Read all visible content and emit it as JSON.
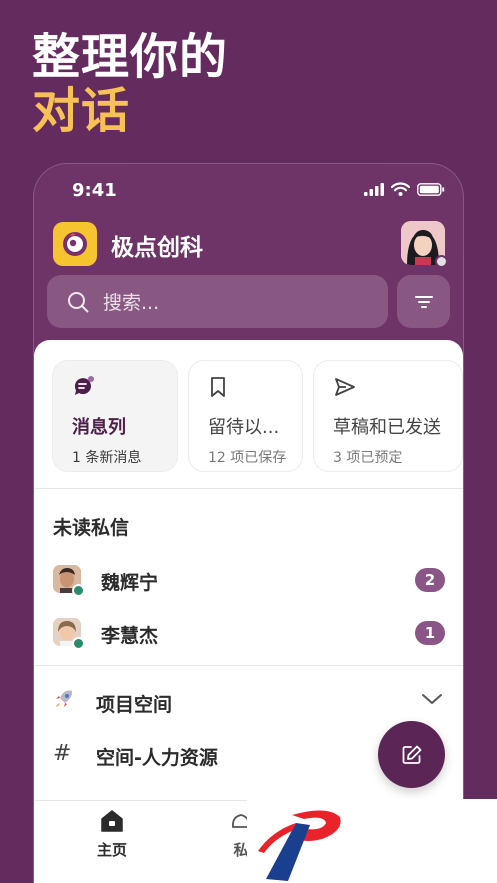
{
  "headline": {
    "line1": "整理你的",
    "line2": "对话"
  },
  "status_bar": {
    "time": "9:41"
  },
  "workspace": {
    "name": "极点创科"
  },
  "search": {
    "placeholder": "搜索..."
  },
  "cards": [
    {
      "icon": "message-list-icon",
      "title": "消息列",
      "subtitle": "1 条新消息",
      "active": true
    },
    {
      "icon": "bookmark-icon",
      "title": "留待以...",
      "subtitle": "12 项已保存",
      "active": false
    },
    {
      "icon": "send-icon",
      "title": "草稿和已发送",
      "subtitle": "3 项已预定",
      "active": false
    }
  ],
  "unread_dms": {
    "label": "未读私信",
    "items": [
      {
        "name": "魏辉宁",
        "count": "2"
      },
      {
        "name": "李慧杰",
        "count": "1"
      }
    ]
  },
  "channels": [
    {
      "icon": "rocket-icon",
      "name": "项目空间"
    },
    {
      "icon": "hash-icon",
      "name": "空间-人力资源"
    }
  ],
  "tabbar": [
    {
      "icon": "home-icon",
      "label": "主页"
    },
    {
      "icon": "dm-icon",
      "label": "私"
    }
  ],
  "colors": {
    "background": "#642b5e",
    "accent_yellow": "#f6c155",
    "badge": "#8a5587",
    "fab": "#5b2556",
    "online": "#2b8a6b"
  }
}
